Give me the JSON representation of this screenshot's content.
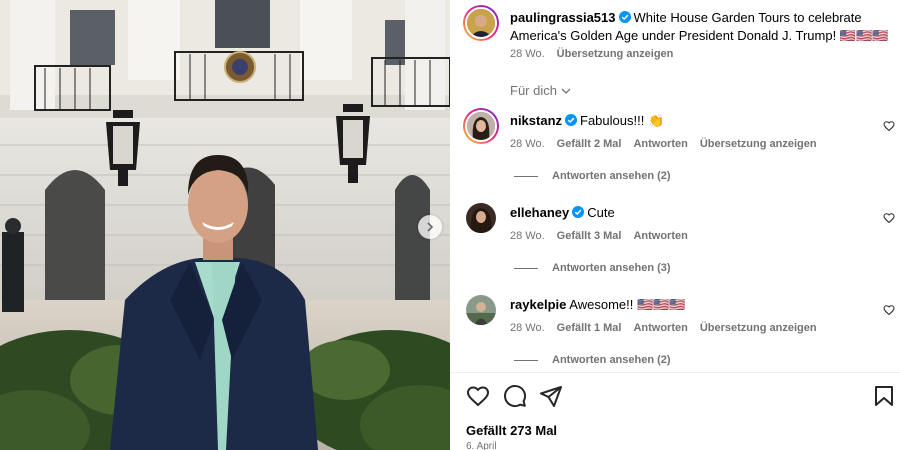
{
  "post": {
    "author": "paulingrassia513",
    "caption": "White House Garden Tours to celebrate America's Golden Age under President Donald J. Trump! 🇺🇸🇺🇸🇺🇸",
    "age": "28 Wo.",
    "translate": "Übersetzung anzeigen"
  },
  "feed_label": "Für dich",
  "comments": [
    {
      "user": "nikstanz",
      "verified": true,
      "text": "Fabulous!!! 👏",
      "age": "28 Wo.",
      "likes": "Gefällt 2 Mal",
      "reply": "Antworten",
      "translate": "Übersetzung anzeigen",
      "view_replies": "Antworten ansehen (2)"
    },
    {
      "user": "ellehaney",
      "verified": true,
      "text": "Cute",
      "age": "28 Wo.",
      "likes": "Gefällt 3 Mal",
      "reply": "Antworten",
      "view_replies": "Antworten ansehen (3)"
    },
    {
      "user": "raykelpie",
      "verified": false,
      "text": "Awesome!! 🇺🇸🇺🇸🇺🇸",
      "age": "28 Wo.",
      "likes": "Gefällt 1 Mal",
      "reply": "Antworten",
      "translate": "Übersetzung anzeigen",
      "view_replies": "Antworten ansehen (2)"
    }
  ],
  "footer": {
    "likes": "Gefällt 273 Mal",
    "date": "6. April"
  },
  "icons": {
    "like": "heart-icon",
    "comment": "comment-icon",
    "share": "share-icon",
    "save": "bookmark-icon",
    "verified": "verified-badge-icon",
    "carousel_next": "chevron-right-icon"
  },
  "colors": {
    "verified": "#0095f6",
    "secondary_text": "#737373"
  }
}
